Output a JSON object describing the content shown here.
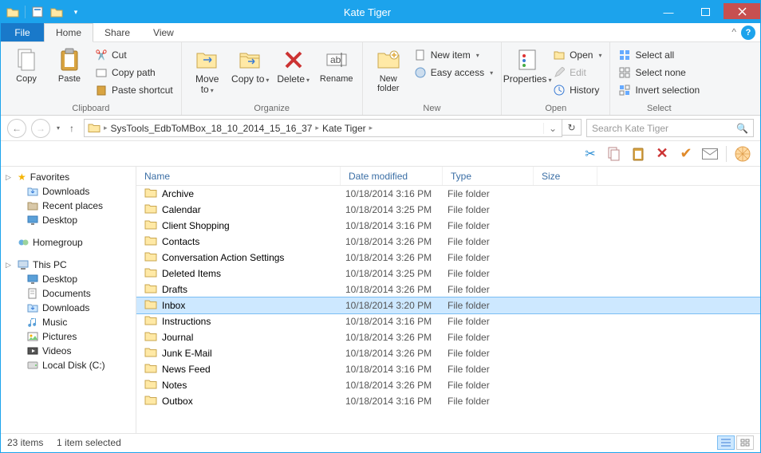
{
  "window": {
    "title": "Kate Tiger"
  },
  "menu": {
    "file": "File",
    "tabs": [
      "Home",
      "Share",
      "View"
    ],
    "active": 0
  },
  "ribbon": {
    "clipboard": {
      "label": "Clipboard",
      "copy": "Copy",
      "paste": "Paste",
      "cut": "Cut",
      "copypath": "Copy path",
      "pasteshortcut": "Paste shortcut"
    },
    "organize": {
      "label": "Organize",
      "moveto": "Move\nto",
      "copyto": "Copy\nto",
      "delete": "Delete",
      "rename": "Rename"
    },
    "new": {
      "label": "New",
      "newfolder": "New\nfolder",
      "newitem": "New item",
      "easyaccess": "Easy access"
    },
    "open": {
      "label": "Open",
      "properties": "Properties",
      "open": "Open",
      "edit": "Edit",
      "history": "History"
    },
    "select": {
      "label": "Select",
      "selectall": "Select all",
      "selectnone": "Select none",
      "invert": "Invert selection"
    }
  },
  "breadcrumb": {
    "parts": [
      "SysTools_EdbToMBox_18_10_2014_15_16_37",
      "Kate Tiger"
    ]
  },
  "search": {
    "placeholder": "Search Kate Tiger"
  },
  "tree": {
    "favorites": "Favorites",
    "fav_items": [
      "Downloads",
      "Recent places",
      "Desktop"
    ],
    "homegroup": "Homegroup",
    "thispc": "This PC",
    "pc_items": [
      "Desktop",
      "Documents",
      "Downloads",
      "Music",
      "Pictures",
      "Videos",
      "Local Disk (C:)"
    ]
  },
  "columns": {
    "name": "Name",
    "date": "Date modified",
    "type": "Type",
    "size": "Size"
  },
  "rows": [
    {
      "name": "Archive",
      "date": "10/18/2014 3:16 PM",
      "type": "File folder"
    },
    {
      "name": "Calendar",
      "date": "10/18/2014 3:25 PM",
      "type": "File folder"
    },
    {
      "name": "Client Shopping",
      "date": "10/18/2014 3:16 PM",
      "type": "File folder"
    },
    {
      "name": "Contacts",
      "date": "10/18/2014 3:26 PM",
      "type": "File folder"
    },
    {
      "name": "Conversation Action Settings",
      "date": "10/18/2014 3:26 PM",
      "type": "File folder"
    },
    {
      "name": "Deleted Items",
      "date": "10/18/2014 3:25 PM",
      "type": "File folder"
    },
    {
      "name": "Drafts",
      "date": "10/18/2014 3:26 PM",
      "type": "File folder"
    },
    {
      "name": "Inbox",
      "date": "10/18/2014 3:20 PM",
      "type": "File folder",
      "selected": true
    },
    {
      "name": "Instructions",
      "date": "10/18/2014 3:16 PM",
      "type": "File folder"
    },
    {
      "name": "Journal",
      "date": "10/18/2014 3:26 PM",
      "type": "File folder"
    },
    {
      "name": "Junk E-Mail",
      "date": "10/18/2014 3:26 PM",
      "type": "File folder"
    },
    {
      "name": "News Feed",
      "date": "10/18/2014 3:16 PM",
      "type": "File folder"
    },
    {
      "name": "Notes",
      "date": "10/18/2014 3:26 PM",
      "type": "File folder"
    },
    {
      "name": "Outbox",
      "date": "10/18/2014 3:16 PM",
      "type": "File folder"
    }
  ],
  "status": {
    "count": "23 items",
    "selected": "1 item selected"
  }
}
